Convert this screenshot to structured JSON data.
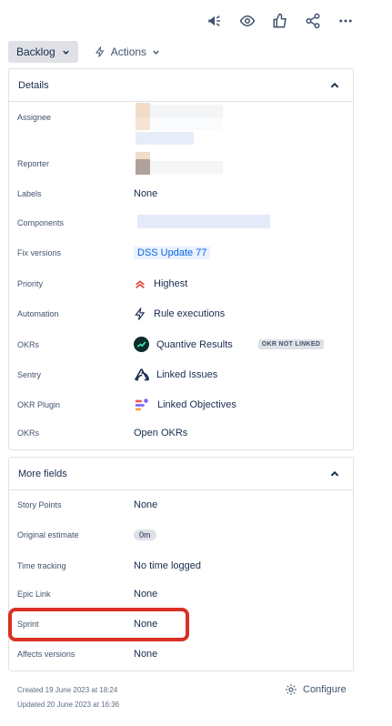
{
  "header": {
    "icons": [
      "megaphone-icon",
      "eye-icon",
      "thumbs-up-icon",
      "share-icon",
      "more-icon"
    ]
  },
  "status": {
    "label": "Backlog",
    "actions_label": "Actions"
  },
  "details": {
    "title": "Details",
    "assignee_label": "Assignee",
    "reporter_label": "Reporter",
    "labels_label": "Labels",
    "labels_value": "None",
    "components_label": "Components",
    "fix_versions_label": "Fix versions",
    "fix_versions_value": "DSS Update 77",
    "priority_label": "Priority",
    "priority_value": "Highest",
    "automation_label": "Automation",
    "automation_value": "Rule executions",
    "okrs_label": "OKRs",
    "okrs_value": "Quantive Results",
    "okrs_badge": "OKR NOT LINKED",
    "sentry_label": "Sentry",
    "sentry_value": "Linked Issues",
    "okr_plugin_label": "OKR Plugin",
    "okr_plugin_value": "Linked Objectives",
    "okrs2_label": "OKRs",
    "okrs2_value": "Open OKRs"
  },
  "more_fields": {
    "title": "More fields",
    "story_points_label": "Story Points",
    "story_points_value": "None",
    "original_estimate_label": "Original estimate",
    "original_estimate_value": "0m",
    "time_tracking_label": "Time tracking",
    "time_tracking_value": "No time logged",
    "epic_link_label": "Epic Link",
    "epic_link_value": "None",
    "sprint_label": "Sprint",
    "sprint_value": "None",
    "affects_versions_label": "Affects versions",
    "affects_versions_value": "None"
  },
  "footer": {
    "created": "Created 19 June 2023 at 18:24",
    "updated": "Updated 20 June 2023 at 16:36",
    "configure_label": "Configure"
  },
  "colors": {
    "highlight": "#d93025",
    "priority_highest": "#e2483d",
    "link_blue": "#0c66e4"
  }
}
